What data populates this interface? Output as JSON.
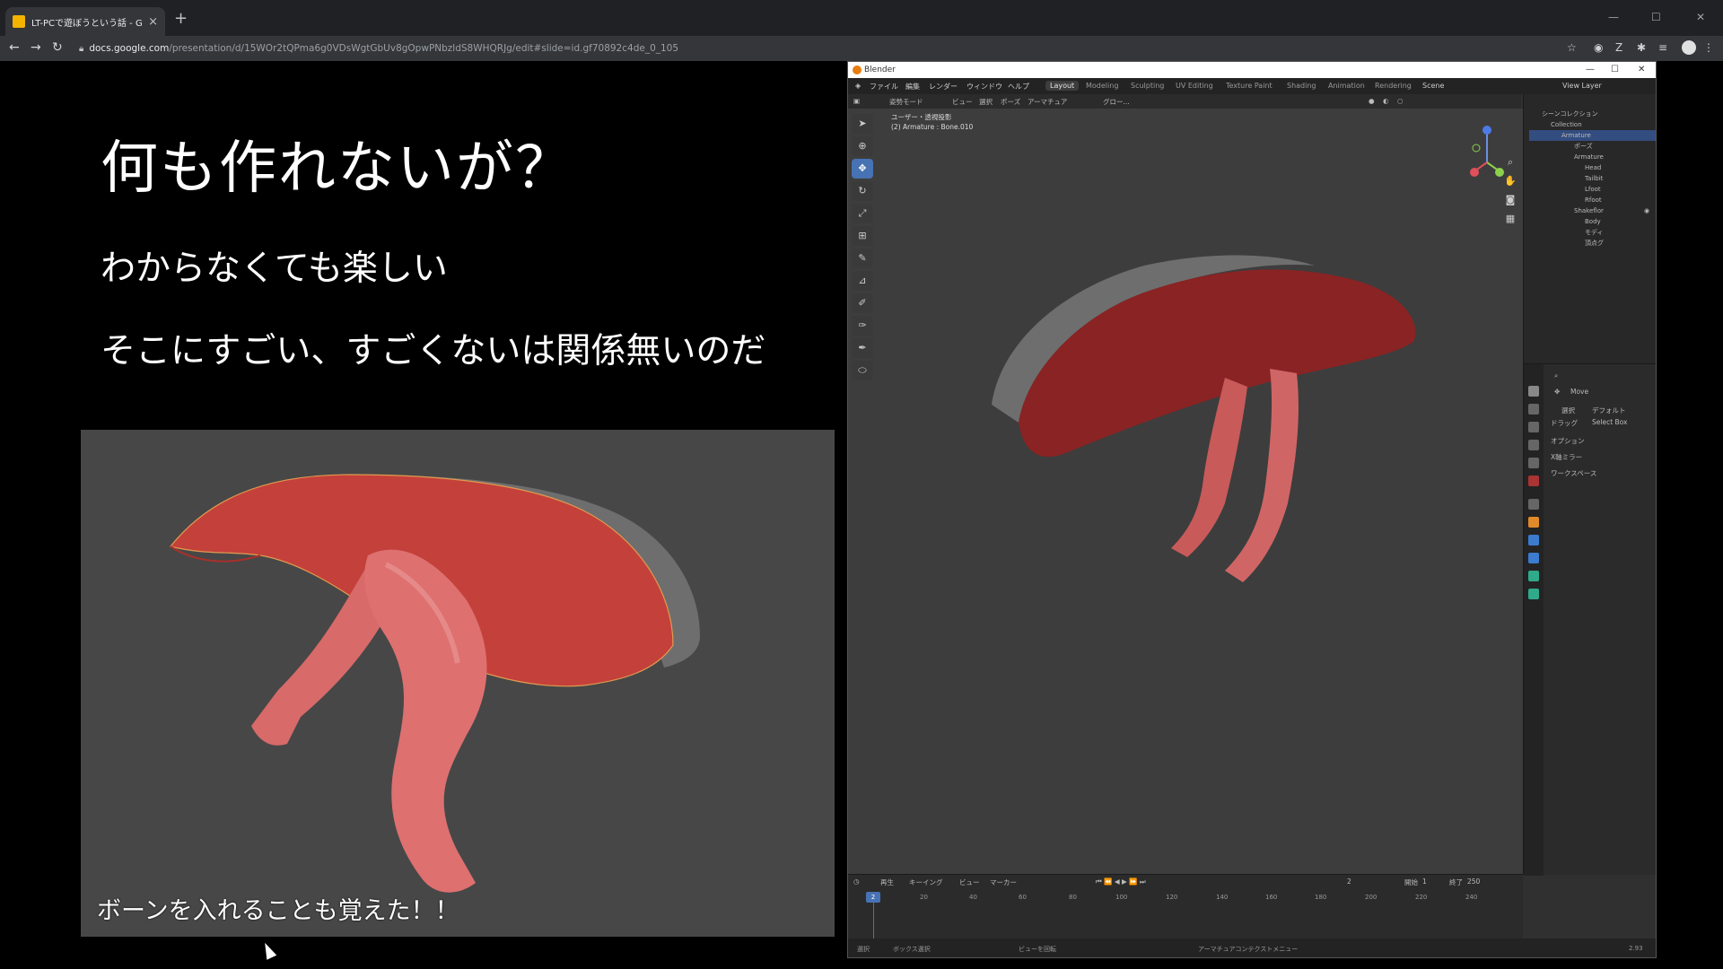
{
  "browser": {
    "tab_title": "LT-PCで遊ぼうという話 - Google ス",
    "tab_close": "×",
    "new_tab": "+",
    "url_host": "docs.google.com",
    "url_path": "/presentation/d/15WOr2tQPma6g0VDsWgtGbUv8gOpwPNbzldS8WHQRJg/edit#slide=id.gf70892c4de_0_105"
  },
  "slide": {
    "title": "何も作れないが？",
    "bullet1": "わからなくても楽しい",
    "bullet2": "そこにすごい、すごくないは関係無いのだ",
    "caption": "ボーンを入れることも覚えた！！"
  },
  "blender": {
    "window_title": "Blender",
    "menus": [
      "ファイル",
      "編集",
      "レンダー",
      "ウィンドウ",
      "ヘルプ"
    ],
    "workspaces": [
      "Layout",
      "Modeling",
      "Sculpting",
      "UV Editing",
      "Texture Paint",
      "Shading",
      "Animation",
      "Rendering"
    ],
    "active_workspace": "Layout",
    "scene": "Scene",
    "view_layer": "View Layer",
    "header": {
      "mode": "姿勢モード",
      "view": "ビュー",
      "select": "選択",
      "pose": "ポーズ",
      "armature": "アーマチュア",
      "global": "グロー..."
    },
    "viewport_info_line1": "ユーザー・透視投影",
    "viewport_info_line2": "(2) Armature : Bone.010",
    "outliner": {
      "scene_collection": "シーンコレクション",
      "items": [
        {
          "label": "Collection",
          "indent": 0
        },
        {
          "label": "Armature",
          "indent": 1,
          "selected": true
        },
        {
          "label": "ポーズ",
          "indent": 2
        },
        {
          "label": "Armature",
          "indent": 2
        },
        {
          "label": "Head",
          "indent": 3
        },
        {
          "label": "Tailbit",
          "indent": 3
        },
        {
          "label": "Lfoot",
          "indent": 3
        },
        {
          "label": "Rfoot",
          "indent": 3
        },
        {
          "label": "Shakeflor",
          "indent": 2
        },
        {
          "label": "Body",
          "indent": 3
        },
        {
          "label": "モディ",
          "indent": 3
        },
        {
          "label": "頂点グ",
          "indent": 3
        }
      ]
    },
    "properties": {
      "tool_name": "Move",
      "select_label": "選択",
      "select_value": "デフォルト",
      "drag_label": "ドラッグ",
      "drag_value": "Select Box",
      "options": "オプション",
      "x_mirror": "X軸ミラー",
      "workspace": "ワークスペース"
    },
    "timeline": {
      "menus": [
        "再生",
        "キーイング",
        "ビュー",
        "マーカー"
      ],
      "current_frame": "2",
      "start_label": "開始",
      "start": "1",
      "end_label": "終了",
      "end": "250",
      "ticks": [
        "0",
        "20",
        "40",
        "60",
        "80",
        "100",
        "120",
        "140",
        "160",
        "180",
        "200",
        "220",
        "240"
      ]
    },
    "status": {
      "select": "選択",
      "box_select": "ボックス選択",
      "rotate_view": "ビューを回転",
      "context_menu": "アーマチュアコンテクストメニュー",
      "version": "2.93"
    }
  },
  "colors": {
    "body_red": "#c4403a",
    "leg_pink": "#d86a6a",
    "shell_grey": "#6e6e6e",
    "blender_accent": "#4772b3"
  }
}
